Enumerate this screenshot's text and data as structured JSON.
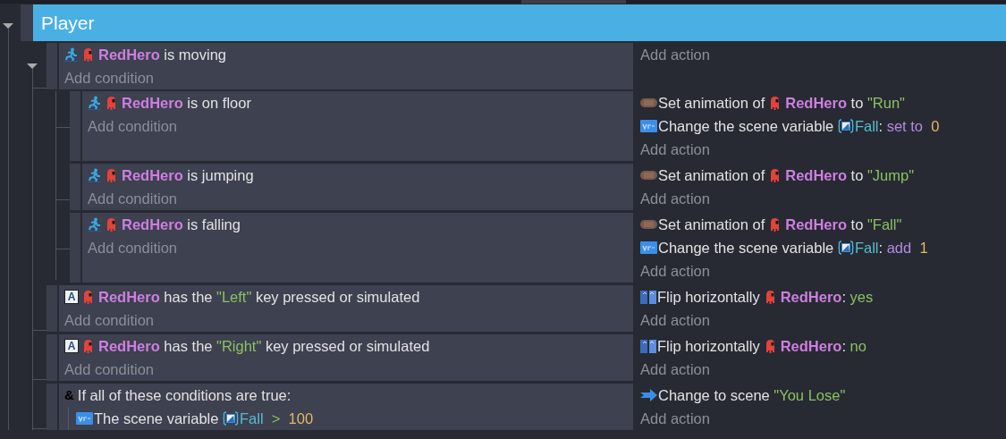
{
  "group": {
    "title": "Player",
    "expanded": true,
    "events": [
      {
        "expanded": true,
        "add_condition": "Add condition",
        "add_action": "Add action",
        "conditions": [
          {
            "kind": "behavior",
            "parts": [
              {
                "kind": "object",
                "text": "RedHero"
              },
              {
                "kind": "text",
                "text": "is moving"
              }
            ]
          }
        ],
        "children": [
          {
            "add_condition": "Add condition",
            "add_action": "Add action",
            "conditions": [
              {
                "kind": "behavior",
                "parts": [
                  {
                    "kind": "object",
                    "text": "RedHero"
                  },
                  {
                    "kind": "text",
                    "text": "is on floor"
                  }
                ]
              }
            ],
            "actions": [
              {
                "kind": "animation",
                "parts": [
                  {
                    "kind": "text",
                    "text": "Set animation of"
                  },
                  {
                    "kind": "object",
                    "text": "RedHero"
                  },
                  {
                    "kind": "text",
                    "text": "to"
                  },
                  {
                    "kind": "string",
                    "text": "\"Run\""
                  }
                ]
              },
              {
                "kind": "variable",
                "parts": [
                  {
                    "kind": "text",
                    "text": "Change the scene variable"
                  },
                  {
                    "kind": "variable",
                    "text": "Fall"
                  },
                  {
                    "kind": "punct",
                    "text": ":"
                  },
                  {
                    "kind": "operator",
                    "text": "set to"
                  },
                  {
                    "kind": "number",
                    "text": "0"
                  }
                ]
              }
            ]
          },
          {
            "add_condition": "Add condition",
            "add_action": "Add action",
            "conditions": [
              {
                "kind": "behavior",
                "parts": [
                  {
                    "kind": "object",
                    "text": "RedHero"
                  },
                  {
                    "kind": "text",
                    "text": "is jumping"
                  }
                ]
              }
            ],
            "actions": [
              {
                "kind": "animation",
                "parts": [
                  {
                    "kind": "text",
                    "text": "Set animation of"
                  },
                  {
                    "kind": "object",
                    "text": "RedHero"
                  },
                  {
                    "kind": "text",
                    "text": "to"
                  },
                  {
                    "kind": "string",
                    "text": "\"Jump\""
                  }
                ]
              }
            ]
          },
          {
            "add_condition": "Add condition",
            "add_action": "Add action",
            "conditions": [
              {
                "kind": "behavior",
                "parts": [
                  {
                    "kind": "object",
                    "text": "RedHero"
                  },
                  {
                    "kind": "text",
                    "text": "is falling"
                  }
                ]
              }
            ],
            "actions": [
              {
                "kind": "animation",
                "parts": [
                  {
                    "kind": "text",
                    "text": "Set animation of"
                  },
                  {
                    "kind": "object",
                    "text": "RedHero"
                  },
                  {
                    "kind": "text",
                    "text": "to"
                  },
                  {
                    "kind": "string",
                    "text": "\"Fall\""
                  }
                ]
              },
              {
                "kind": "variable",
                "parts": [
                  {
                    "kind": "text",
                    "text": "Change the scene variable"
                  },
                  {
                    "kind": "variable",
                    "text": "Fall"
                  },
                  {
                    "kind": "punct",
                    "text": ":"
                  },
                  {
                    "kind": "operator",
                    "text": "add"
                  },
                  {
                    "kind": "number",
                    "text": "1"
                  }
                ]
              }
            ]
          }
        ]
      },
      {
        "add_condition": "Add condition",
        "add_action": "Add action",
        "conditions": [
          {
            "kind": "key",
            "symbol": "A",
            "parts": [
              {
                "kind": "object",
                "text": "RedHero"
              },
              {
                "kind": "text",
                "text": "has the"
              },
              {
                "kind": "string",
                "text": "\"Left\""
              },
              {
                "kind": "text",
                "text": "key pressed or simulated"
              }
            ]
          }
        ],
        "actions": [
          {
            "kind": "flip",
            "parts": [
              {
                "kind": "text",
                "text": "Flip horizontally"
              },
              {
                "kind": "object",
                "text": "RedHero"
              },
              {
                "kind": "punct",
                "text": ":"
              },
              {
                "kind": "string",
                "text": "yes"
              }
            ]
          }
        ]
      },
      {
        "add_condition": "Add condition",
        "add_action": "Add action",
        "conditions": [
          {
            "kind": "key",
            "symbol": "A",
            "parts": [
              {
                "kind": "object",
                "text": "RedHero"
              },
              {
                "kind": "text",
                "text": "has the"
              },
              {
                "kind": "string",
                "text": "\"Right\""
              },
              {
                "kind": "text",
                "text": "key pressed or simulated"
              }
            ]
          }
        ],
        "actions": [
          {
            "kind": "flip",
            "parts": [
              {
                "kind": "text",
                "text": "Flip horizontally"
              },
              {
                "kind": "object",
                "text": "RedHero"
              },
              {
                "kind": "punct",
                "text": ":"
              },
              {
                "kind": "string",
                "text": "no"
              }
            ]
          }
        ]
      },
      {
        "add_action": "Add action",
        "conditions": [
          {
            "kind": "and",
            "symbol": "&",
            "parts": [
              {
                "kind": "text",
                "text": "If all of these conditions are true:"
              }
            ],
            "subconditions": [
              {
                "kind": "variable",
                "parts": [
                  {
                    "kind": "text",
                    "text": "The scene variable"
                  },
                  {
                    "kind": "variable",
                    "text": "Fall"
                  },
                  {
                    "kind": "comparison",
                    "text": ">"
                  },
                  {
                    "kind": "number",
                    "text": "100"
                  }
                ]
              }
            ]
          }
        ],
        "actions": [
          {
            "kind": "scene",
            "parts": [
              {
                "kind": "text",
                "text": "Change to scene"
              },
              {
                "kind": "string",
                "text": "\"You Lose\""
              }
            ]
          }
        ]
      }
    ]
  }
}
